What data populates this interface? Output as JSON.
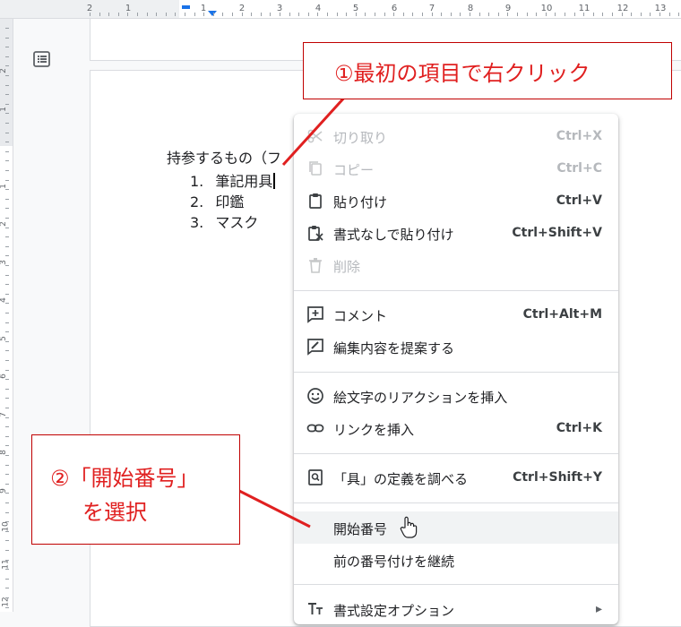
{
  "ruler": {
    "numbers": [
      "2",
      "1",
      "1",
      "2",
      "3",
      "4",
      "5",
      "6",
      "7",
      "8",
      "9",
      "10",
      "11",
      "12",
      "13"
    ],
    "vertical_numbers": [
      "2",
      "1",
      "1",
      "2",
      "3",
      "4",
      "5",
      "6",
      "7",
      "8",
      "9",
      "10",
      "11",
      "12"
    ]
  },
  "document": {
    "heading": "持参するもの（フ",
    "list": [
      {
        "num": "1.",
        "text": "筆記用具"
      },
      {
        "num": "2.",
        "text": "印鑑"
      },
      {
        "num": "3.",
        "text": "マスク"
      }
    ]
  },
  "context_menu": {
    "items": [
      {
        "icon": "scissors-icon",
        "label": "切り取り",
        "shortcut": "Ctrl+X",
        "disabled": true
      },
      {
        "icon": "copy-icon",
        "label": "コピー",
        "shortcut": "Ctrl+C",
        "disabled": true
      },
      {
        "icon": "clipboard-icon",
        "label": "貼り付け",
        "shortcut": "Ctrl+V",
        "disabled": false
      },
      {
        "icon": "clipboard-plain-icon",
        "label": "書式なしで貼り付け",
        "shortcut": "Ctrl+Shift+V",
        "disabled": false
      },
      {
        "icon": "trash-icon",
        "label": "削除",
        "shortcut": "",
        "disabled": true
      },
      {
        "icon": "comment-add-icon",
        "label": "コメント",
        "shortcut": "Ctrl+Alt+M",
        "disabled": false
      },
      {
        "icon": "suggest-edit-icon",
        "label": "編集内容を提案する",
        "shortcut": "",
        "disabled": false
      },
      {
        "icon": "emoji-icon",
        "label": "絵文字のリアクションを挿入",
        "shortcut": "",
        "disabled": false
      },
      {
        "icon": "link-icon",
        "label": "リンクを挿入",
        "shortcut": "Ctrl+K",
        "disabled": false
      },
      {
        "icon": "define-icon",
        "label": "「具」の定義を調べる",
        "shortcut": "Ctrl+Shift+Y",
        "disabled": false
      },
      {
        "icon": "",
        "label": "開始番号",
        "shortcut": "",
        "disabled": false,
        "hovered": true
      },
      {
        "icon": "",
        "label": "前の番号付けを継続",
        "shortcut": "",
        "disabled": false
      },
      {
        "icon": "text-format-icon",
        "label": "書式設定オプション",
        "shortcut": "▸",
        "disabled": false
      }
    ]
  },
  "annotations": {
    "callout1": "①最初の項目で右クリック",
    "callout2_line1": "②「開始番号」",
    "callout2_line2": "を選択"
  },
  "colors": {
    "annotation": "#e02020",
    "accent": "#1a73e8"
  }
}
